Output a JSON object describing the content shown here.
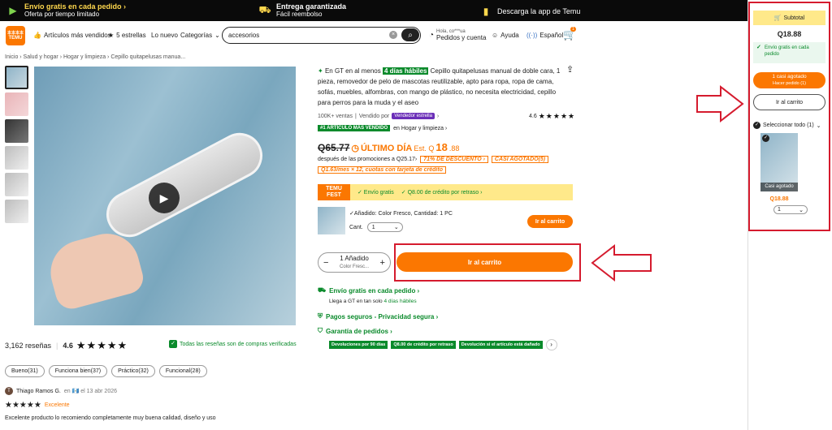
{
  "topbar": {
    "free_ship_title": "Envío gratis en cada pedido",
    "free_ship_sub": "Oferta por tiempo limitado",
    "delivery_title": "Entrega garantizada",
    "delivery_sub": "Fácil reembolso",
    "app_cta": "Descarga la app de Temu",
    "chevron": "›"
  },
  "header": {
    "logo_top": "本本本本",
    "logo_bottom": "TEMU",
    "nav": [
      "Artículos más vendidos",
      "5 estrellas",
      "Lo nuevo",
      "Categorías"
    ],
    "search_value": "accesorios",
    "greeting": "Hola, co***ua",
    "account": "Pedidos y cuenta",
    "help": "Ayuda",
    "language": "Español",
    "cart_count": "1"
  },
  "breadcrumb": "Inicio › Salud y hogar › Hogar y limpieza › Cepillo quitapelusas manua...",
  "product": {
    "title_prefix": "En GT en al menos",
    "title_highlight": "4 días hábiles",
    "title_rest": "Cepillo quitapelusas manual de doble cara, 1 pieza, removedor de pelo de mascotas reutilizable, apto para ropa, ropa de cama, sofás, muebles, alfombras, con mango de plástico, no necesita electricidad, cepillo para perros para la muda y el aseo",
    "sales": "100K+ ventas",
    "sold_by": "Vendido por",
    "star_seller": "Vendedor estrella",
    "rating_value": "4.6",
    "bestseller_tag": "#1 ARTÍCULO MÁS VENDIDO",
    "bestseller_cat": "en Hogar y limpieza ›",
    "old_price": "Q65.77",
    "last_day": "ÚLTIMO DÍA",
    "est": "Est. Q",
    "price": "18",
    "price_dec": ".88",
    "after_promo": "después de las promociones a Q25.17›",
    "discount_tag": "71% DE DESCUENTO ›",
    "almost_gone_tag": "CASI AGOTADO(5)",
    "installments_tag": "Q1.63/mes × 12, cuotas con tarjeta de crédito"
  },
  "fest": {
    "tag_top": "TEMU",
    "tag_bottom": "FEST",
    "free_ship": "✓ Envío gratis",
    "credit": "✓ Q8.00 de crédito por retraso ›"
  },
  "added": {
    "text": "✓Añadido: Color Fresco, Cantidad: 1 PC",
    "qty_label": "Cant.",
    "qty_value": "1",
    "cart_button": "Ir al carrito"
  },
  "stepper": {
    "minus": "−",
    "plus": "+",
    "count": "1 Añadido",
    "variant": "Color Fresc..."
  },
  "add_to_cart": "Ir al carrito",
  "shipping": {
    "title": "Envío gratis en cada pedido ›",
    "sub_prefix": "Llega a GT en tan solo",
    "sub_highlight": "4 días hábiles"
  },
  "payments": "Pagos seguros - Privacidad segura ›",
  "guarantee": {
    "title": "Garantía de pedidos ›",
    "tags": [
      "Devoluciones por 90 días",
      "Q8.00 de crédito por retraso",
      "Devolución si el artículo está dañado"
    ]
  },
  "reviews": {
    "count": "3,162 reseñas",
    "rating": "4.6",
    "stars": "★★★★★",
    "verified": "Todas las reseñas son de compras verificadas",
    "chips": [
      "Bueno(31)",
      "Funciona bien(37)",
      "Práctico(32)",
      "Funcional(28)"
    ],
    "reviewer_initial": "T",
    "reviewer": "Thiago Ramos G.",
    "reviewer_date": "en 🇬🇹 el 13 abr 2026",
    "review_stars": "★★★★★",
    "review_label": "Excelente",
    "review_text": "Excelente producto lo recomiendo completamente muy buena calidad, diseño y uso"
  },
  "sidebar": {
    "subtotal": "Subtotal",
    "price": "Q18.88",
    "free_ship": "Envío gratis en cada pedido",
    "almost_gone": "1 casi agotado",
    "order_now": "Hacer pedido (1)",
    "cart_button": "Ir al carrito",
    "select_all": "Seleccionar todo (1)",
    "item_caption": "Casi agotado",
    "item_price": "Q18.88",
    "item_qty": "1"
  },
  "colors": {
    "accent": "#fb7701",
    "green": "#0a8a2b",
    "highlight_red": "#d51b2e"
  }
}
